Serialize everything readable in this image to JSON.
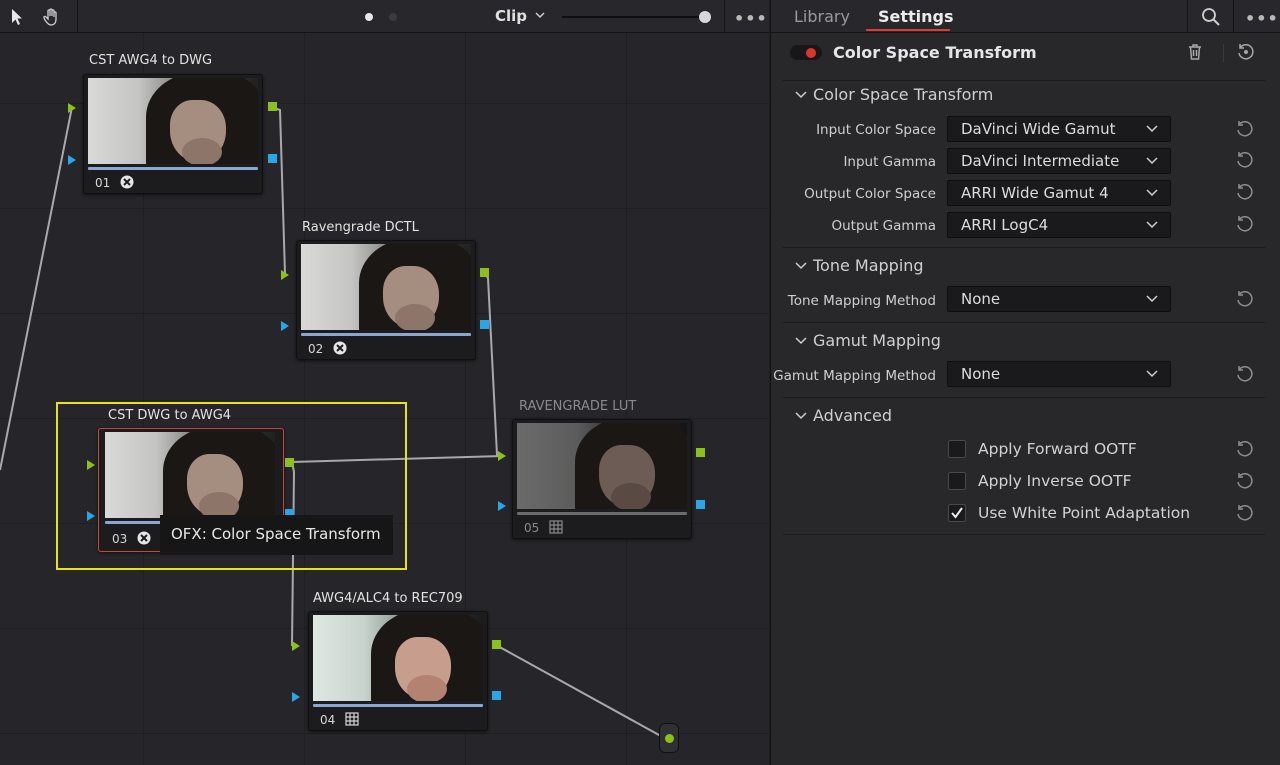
{
  "toolbar": {
    "pointer_tool": "pointer-icon",
    "hand_tool": "hand-icon",
    "clip_label": "Clip",
    "more": "•••"
  },
  "nodes": [
    {
      "title": "CST AWG4 to DWG",
      "number": "01",
      "icon": "ofx-icon"
    },
    {
      "title": "Ravengrade DCTL",
      "number": "02",
      "icon": "ofx-icon"
    },
    {
      "title": "CST DWG to AWG4",
      "number": "03",
      "icon": "ofx-icon"
    },
    {
      "title": "RAVENGRADE LUT",
      "number": "05",
      "icon": "lut-grid-icon"
    },
    {
      "title": "AWG4/ALC4 to REC709",
      "number": "04",
      "icon": "lut-grid-icon"
    }
  ],
  "tooltip": "OFX: Color Space Transform",
  "panel": {
    "tabs": [
      "Library",
      "Settings"
    ],
    "active_tab": "Settings",
    "more": "•••",
    "effect_title": "Color Space Transform",
    "sections": {
      "cst": "Color Space Transform",
      "tone": "Tone Mapping",
      "gamut": "Gamut Mapping",
      "advanced": "Advanced"
    },
    "fields": {
      "input_color_space": {
        "label": "Input Color Space",
        "value": "DaVinci Wide Gamut"
      },
      "input_gamma": {
        "label": "Input Gamma",
        "value": "DaVinci Intermediate"
      },
      "output_color_space": {
        "label": "Output Color Space",
        "value": "ARRI Wide Gamut 4"
      },
      "output_gamma": {
        "label": "Output Gamma",
        "value": "ARRI LogC4"
      },
      "tone_mapping_method": {
        "label": "Tone Mapping Method",
        "value": "None"
      },
      "gamut_mapping_method": {
        "label": "Gamut Mapping Method",
        "value": "None"
      }
    },
    "checkboxes": {
      "forward_ootf": {
        "label": "Apply Forward OOTF",
        "checked": false
      },
      "inverse_ootf": {
        "label": "Apply Inverse OOTF",
        "checked": false
      },
      "white_point": {
        "label": "Use White Point Adaptation",
        "checked": true
      }
    }
  },
  "colors": {
    "accent_red": "#e23b2d",
    "port_green": "#8cc11c",
    "port_blue": "#2aa6e6",
    "selection_yellow": "#e8e11c"
  }
}
